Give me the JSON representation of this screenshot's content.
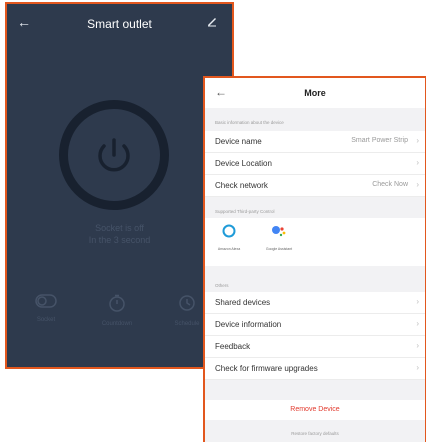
{
  "outlet_screen": {
    "back_glyph": "←",
    "title": "Smart outlet",
    "status_line1": "Socket is off",
    "status_line2": "In the 3 second",
    "controls": [
      {
        "label": "Socket",
        "icon": "toggle-icon"
      },
      {
        "label": "Countdown",
        "icon": "timer-icon"
      },
      {
        "label": "Schedule",
        "icon": "clock-icon"
      }
    ]
  },
  "more_screen": {
    "back_glyph": "←",
    "title": "More",
    "section_basic": "Basic information about the device",
    "rows_basic": [
      {
        "label": "Device name",
        "value": "Smart Power Strip"
      },
      {
        "label": "Device Location",
        "value": ""
      },
      {
        "label": "Check network",
        "value": "Check Now"
      }
    ],
    "section_thirdparty": "Supported Third-party Control",
    "third_party": [
      {
        "label": "Amazon Alexa",
        "icon": "alexa-icon"
      },
      {
        "label": "Google Assistant",
        "icon": "google-assistant-icon"
      }
    ],
    "section_others": "Others",
    "rows_others": [
      {
        "label": "Shared devices"
      },
      {
        "label": "Device information"
      },
      {
        "label": "Feedback"
      },
      {
        "label": "Check for firmware upgrades"
      }
    ],
    "chevron": "›",
    "remove_label": "Remove Device",
    "restore_label": "Restore factory defaults"
  }
}
